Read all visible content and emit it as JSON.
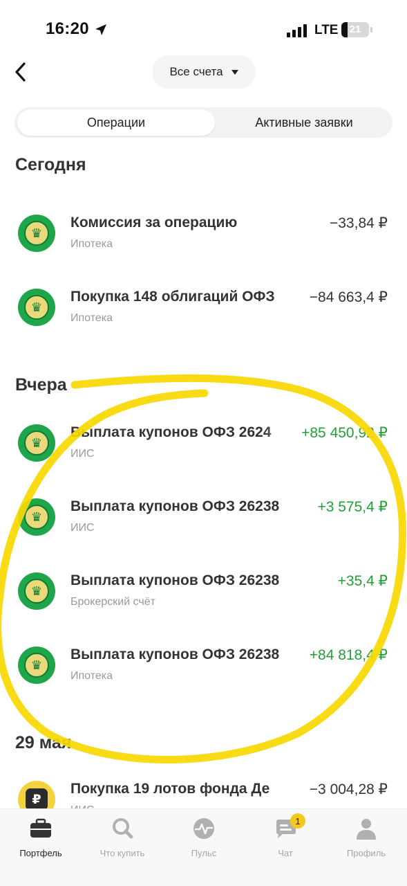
{
  "status_bar": {
    "time": "16:20",
    "network": "LTE",
    "battery": "21"
  },
  "header": {
    "back_icon": "chevron-left-icon",
    "account_selector": "Все счета"
  },
  "segments": [
    {
      "label": "Операции",
      "active": true
    },
    {
      "label": "Активные заявки",
      "active": false
    }
  ],
  "sections": [
    {
      "title": "Сегодня",
      "items": [
        {
          "title": "Комиссия за операцию",
          "account": "Ипотека",
          "amount": "−33,84 ₽",
          "sign": "negative",
          "icon": "bond-issuer-logo-icon"
        },
        {
          "title": "Покупка 148 облигаций ОФЗ",
          "account": "Ипотека",
          "amount": "−84 663,4 ₽",
          "sign": "negative",
          "icon": "bond-issuer-logo-icon"
        }
      ]
    },
    {
      "title": "Вчера",
      "items": [
        {
          "title": "Выплата купонов ОФЗ 2624",
          "account": "ИИС",
          "amount": "+85 450,92 ₽",
          "sign": "positive",
          "icon": "bond-issuer-logo-icon"
        },
        {
          "title": "Выплата купонов ОФЗ 26238",
          "account": "ИИС",
          "amount": "+3 575,4 ₽",
          "sign": "positive",
          "icon": "bond-issuer-logo-icon"
        },
        {
          "title": "Выплата купонов ОФЗ 26238",
          "account": "Брокерский счёт",
          "amount": "+35,4 ₽",
          "sign": "positive",
          "icon": "bond-issuer-logo-icon"
        },
        {
          "title": "Выплата купонов ОФЗ 26238",
          "account": "Ипотека",
          "amount": "+84 818,4 ₽",
          "sign": "positive",
          "icon": "bond-issuer-logo-icon"
        }
      ]
    },
    {
      "title": "29 мая",
      "items": [
        {
          "title": "Покупка 19 лотов фонда Де",
          "account": "ИИС",
          "amount": "−3 004,28 ₽",
          "sign": "negative",
          "icon": "fund-logo-icon"
        }
      ]
    }
  ],
  "tabbar": {
    "tabs": [
      {
        "label": "Портфель",
        "icon": "briefcase-icon",
        "active": true
      },
      {
        "label": "Что купить",
        "icon": "search-icon",
        "active": false
      },
      {
        "label": "Пульс",
        "icon": "pulse-icon",
        "active": false
      },
      {
        "label": "Чат",
        "icon": "chat-icon",
        "active": false,
        "badge": "1"
      },
      {
        "label": "Профиль",
        "icon": "profile-icon",
        "active": false
      }
    ]
  },
  "colors": {
    "positive": "#21a038",
    "negative": "#333333",
    "brand_green": "#1fa54a",
    "highlight_annotation": "#f7d800",
    "badge": "#f6c81e"
  }
}
